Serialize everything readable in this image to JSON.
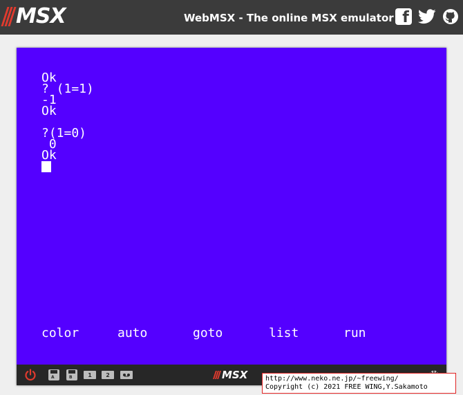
{
  "header": {
    "logo_text": "MSX",
    "title": "WebMSX - The online MSX emulator",
    "social": [
      {
        "name": "facebook-icon",
        "glyph": "f"
      },
      {
        "name": "twitter-icon"
      },
      {
        "name": "github-icon"
      }
    ]
  },
  "screen": {
    "background": "#5400ff",
    "text_color": "#ffffff",
    "lines": [
      "Ok",
      "? (1=1)",
      "-1",
      "Ok",
      "",
      "?(1=0)",
      " 0",
      "Ok"
    ],
    "function_keys": [
      "color",
      "auto",
      "goto",
      "list",
      "run"
    ]
  },
  "controls": {
    "disk_a_label": "A",
    "disk_b_label": "B",
    "cart1_label": "1",
    "cart2_label": "2",
    "logo_text": "MSX"
  },
  "copyright": {
    "line1": "http://www.neko.ne.jp/~freewing/",
    "line2": "Copyright (c) 2021 FREE WING,Y.Sakamoto"
  }
}
